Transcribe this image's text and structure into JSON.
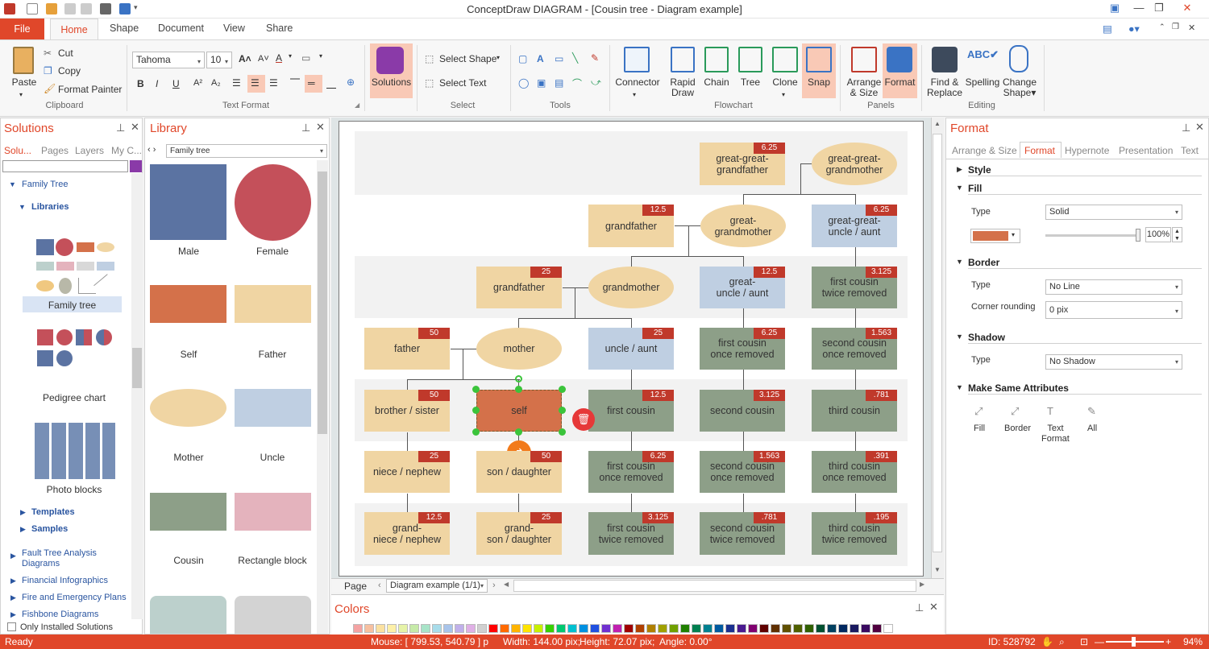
{
  "window": {
    "title": "ConceptDraw DIAGRAM - [Cousin tree - Diagram example]"
  },
  "tabs": {
    "file": "File",
    "home": "Home",
    "shape": "Shape",
    "document": "Document",
    "view": "View",
    "share": "Share"
  },
  "ribbon": {
    "clipboard": {
      "paste": "Paste",
      "cut": "Cut",
      "copy": "Copy",
      "format_painter": "Format Painter",
      "label": "Clipboard"
    },
    "text_format": {
      "font": "Tahoma",
      "size": "10",
      "label": "Text Format"
    },
    "solutions": {
      "label": "Solutions"
    },
    "select": {
      "select_shape": "Select Shape",
      "select_text": "Select Text",
      "label": "Select"
    },
    "tools": {
      "label": "Tools"
    },
    "flowchart": {
      "connector": "Connector",
      "rapid_draw": "Rapid Draw",
      "rapid_line1": "Rapid",
      "rapid_line2": "Draw",
      "chain": "Chain",
      "tree": "Tree",
      "clone": "Clone",
      "snap": "Snap",
      "label": "Flowchart"
    },
    "panels": {
      "arrange1": "Arrange",
      "arrange2": "& Size",
      "format": "Format",
      "label": "Panels"
    },
    "editing": {
      "find1": "Find &",
      "find2": "Replace",
      "spelling": "Spelling",
      "change1": "Change",
      "change2": "Shape",
      "label": "Editing"
    }
  },
  "solutions_panel": {
    "title": "Solutions",
    "tabs": [
      "Solu...",
      "Pages",
      "Layers",
      "My C..."
    ],
    "tree": {
      "family_tree": "Family Tree",
      "libraries": "Libraries",
      "family_tree_lib": "Family tree",
      "pedigree": "Pedigree chart",
      "photo_blocks": "Photo blocks",
      "templates": "Templates",
      "samples": "Samples"
    },
    "items": [
      "Fault Tree Analysis",
      "Diagrams",
      "Financial Infographics",
      "Fire and Emergency Plans",
      "Fishbone Diagrams"
    ],
    "only_installed": "Only Installed Solutions"
  },
  "library_panel": {
    "title": "Library",
    "selected": "Family tree",
    "shapes": [
      "Male",
      "Female",
      "Self",
      "Father",
      "Mother",
      "Uncle",
      "Cousin",
      "Rectangle block"
    ]
  },
  "diagram": {
    "nodes": {
      "ggf": {
        "line1": "great-great-",
        "line2": "grandfather",
        "badge": "6.25"
      },
      "ggm": {
        "line1": "great-great-",
        "line2": "grandmother"
      },
      "gf1": {
        "text": "grandfather",
        "badge": "12.5"
      },
      "gm1": {
        "line1": "great-",
        "line2": "grandmother"
      },
      "ggu": {
        "line1": "great-great-",
        "line2": "uncle / aunt",
        "badge": "6.25"
      },
      "gf2": {
        "text": "grandfather",
        "badge": "25"
      },
      "gm2": {
        "text": "grandmother"
      },
      "gu": {
        "line1": "great-",
        "line2": "uncle / aunt",
        "badge": "12.5"
      },
      "fc2r1": {
        "line1": "first cousin",
        "line2": "twice removed",
        "badge": "3.125"
      },
      "father": {
        "text": "father",
        "badge": "50"
      },
      "mother": {
        "text": "mother"
      },
      "uncle": {
        "text": "uncle / aunt",
        "badge": "25"
      },
      "fc1r1": {
        "line1": "first cousin",
        "line2": "once removed",
        "badge": "6.25"
      },
      "sc1r1": {
        "line1": "second cousin",
        "line2": "once removed",
        "badge": "1.563"
      },
      "bro": {
        "text": "brother / sister",
        "badge": "50"
      },
      "self": {
        "text": "self"
      },
      "fc": {
        "text": "first cousin",
        "badge": "12.5"
      },
      "sc": {
        "text": "second cousin",
        "badge": "3.125"
      },
      "tc": {
        "text": "third cousin",
        "badge": ".781"
      },
      "niece": {
        "text": "niece / nephew",
        "badge": "25"
      },
      "son": {
        "text": "son / daughter",
        "badge": "50"
      },
      "fc1r2": {
        "line1": "first cousin",
        "line2": "once removed",
        "badge": "6.25"
      },
      "sc1r2": {
        "line1": "second cousin",
        "line2": "once removed",
        "badge": "1.563"
      },
      "tc1r": {
        "line1": "third cousin",
        "line2": "once removed",
        "badge": ".391"
      },
      "gniece": {
        "line1": "grand-",
        "line2": "niece / nephew",
        "badge": "12.5"
      },
      "gson": {
        "line1": "grand-",
        "line2": "son / daughter",
        "badge": "25"
      },
      "fc2r2": {
        "line1": "first cousin",
        "line2": "twice removed",
        "badge": "3.125"
      },
      "sc2r": {
        "line1": "second cousin",
        "line2": "twice removed",
        "badge": ".781"
      },
      "tc2r": {
        "line1": "third cousin",
        "line2": "twice removed",
        "badge": ".195"
      }
    }
  },
  "page_bar": {
    "page": "Page",
    "current": "Diagram example (1/1)"
  },
  "colors_panel": {
    "title": "Colors"
  },
  "format_panel": {
    "title": "Format",
    "tabs": [
      "Arrange & Size",
      "Format",
      "Hypernote",
      "Presentation",
      "Text"
    ],
    "style": "Style",
    "fill": "Fill",
    "type_label": "Type",
    "fill_type": "Solid",
    "opacity": "100%",
    "border": "Border",
    "border_type": "No Line",
    "corner_label": "Corner rounding",
    "corner_value": "0 pix",
    "shadow": "Shadow",
    "shadow_type": "No Shadow",
    "make_same": "Make Same Attributes",
    "ms_fill": "Fill",
    "ms_border": "Border",
    "ms_text1": "Text",
    "ms_text2": "Format",
    "ms_all": "All",
    "fill_color": "#d4714a"
  },
  "status": {
    "ready": "Ready",
    "mouse": "Mouse: [ 799.53, 540.79 ] p",
    "width": "Width: 144.00 pix;",
    "height": "Height: 72.07 pix;",
    "angle": "Angle: 0.00°",
    "id": "ID: 528792",
    "zoom": "94%"
  },
  "colors": {
    "accent": "#e0472a",
    "male": "#5b73a2",
    "female": "#c4505a",
    "self": "#d4714a",
    "father": "#f0d5a3",
    "uncle": "#bfcfe2",
    "cousin": "#8d9f88",
    "rect_block": "#e4b3bd"
  }
}
